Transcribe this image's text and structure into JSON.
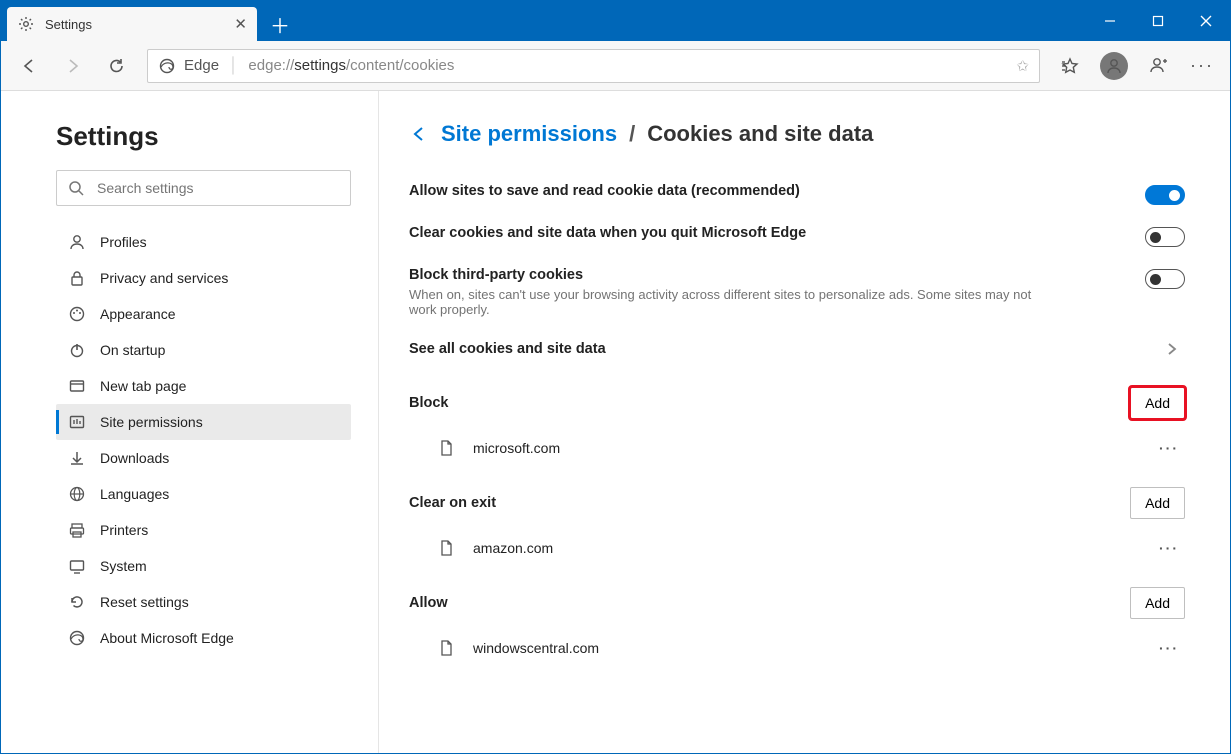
{
  "window": {
    "tab_title": "Settings"
  },
  "address": {
    "app_label": "Edge",
    "url_grey_prefix": "edge://",
    "url_dark": "settings",
    "url_grey_suffix": "/content/cookies"
  },
  "sidebar": {
    "heading": "Settings",
    "search_placeholder": "Search settings",
    "items": [
      {
        "label": "Profiles",
        "icon": "person"
      },
      {
        "label": "Privacy and services",
        "icon": "lock"
      },
      {
        "label": "Appearance",
        "icon": "palette"
      },
      {
        "label": "On startup",
        "icon": "power"
      },
      {
        "label": "New tab page",
        "icon": "newtab"
      },
      {
        "label": "Site permissions",
        "icon": "permissions",
        "active": true
      },
      {
        "label": "Downloads",
        "icon": "download"
      },
      {
        "label": "Languages",
        "icon": "language"
      },
      {
        "label": "Printers",
        "icon": "printer"
      },
      {
        "label": "System",
        "icon": "system"
      },
      {
        "label": "Reset settings",
        "icon": "reset"
      },
      {
        "label": "About Microsoft Edge",
        "icon": "edge"
      }
    ]
  },
  "main": {
    "breadcrumb_link": "Site permissions",
    "breadcrumb_current": "Cookies and site data",
    "toggles": [
      {
        "label": "Allow sites to save and read cookie data (recommended)",
        "on": true
      },
      {
        "label": "Clear cookies and site data when you quit Microsoft Edge",
        "on": false
      },
      {
        "label": "Block third-party cookies",
        "on": false,
        "desc": "When on, sites can't use your browsing activity across different sites to personalize ads. Some sites may not work properly."
      }
    ],
    "see_all_label": "See all cookies and site data",
    "sections": [
      {
        "title": "Block",
        "add_label": "Add",
        "highlight": true,
        "items": [
          {
            "site": "microsoft.com"
          }
        ]
      },
      {
        "title": "Clear on exit",
        "add_label": "Add",
        "highlight": false,
        "items": [
          {
            "site": "amazon.com"
          }
        ]
      },
      {
        "title": "Allow",
        "add_label": "Add",
        "highlight": false,
        "items": [
          {
            "site": "windowscentral.com"
          }
        ]
      }
    ]
  }
}
